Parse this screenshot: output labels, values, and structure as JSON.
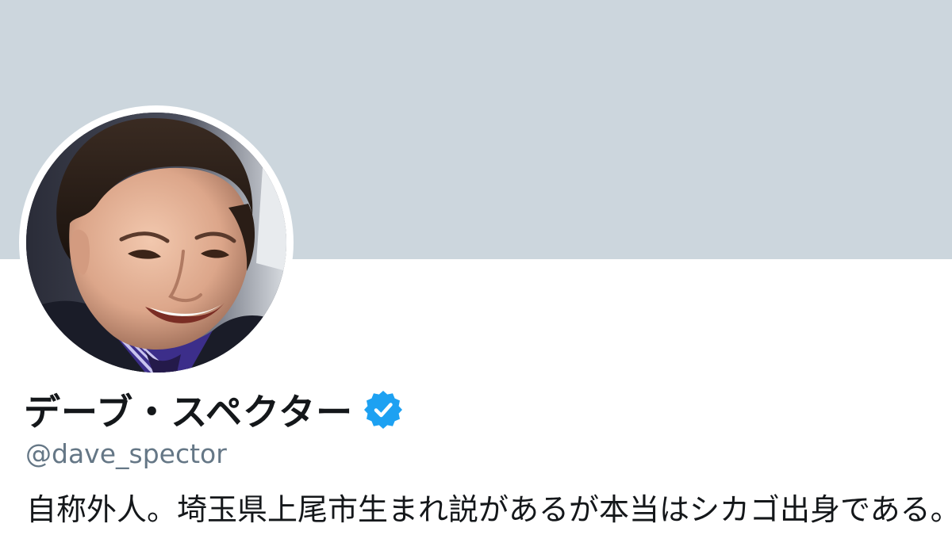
{
  "profile": {
    "display_name": "デーブ・スペクター",
    "verified": true,
    "handle": "@dave_spector",
    "bio": "自称外人。埼玉県上尾市生まれ説があるが本当はシカゴ出身である。芸"
  },
  "icons": {
    "verified": "verified-badge-icon"
  },
  "colors": {
    "banner": "#ccd6dd",
    "verified": "#1da1f2",
    "name_text": "#14171a",
    "handle_text": "#657786",
    "background": "#ffffff"
  }
}
